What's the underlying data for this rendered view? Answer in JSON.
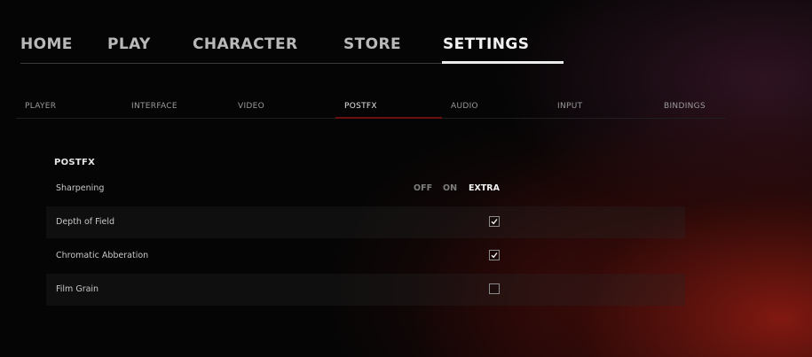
{
  "top_nav": {
    "tabs": [
      {
        "label": "HOME"
      },
      {
        "label": "PLAY"
      },
      {
        "label": "CHARACTER"
      },
      {
        "label": "STORE"
      },
      {
        "label": "SETTINGS"
      }
    ],
    "active": "SETTINGS"
  },
  "sub_nav": {
    "tabs": [
      {
        "label": "PLAYER"
      },
      {
        "label": "INTERFACE"
      },
      {
        "label": "VIDEO"
      },
      {
        "label": "POSTFX"
      },
      {
        "label": "AUDIO"
      },
      {
        "label": "INPUT"
      },
      {
        "label": "BINDINGS"
      }
    ],
    "active": "POSTFX"
  },
  "postfx": {
    "section_title": "POSTFX",
    "sharpening": {
      "label": "Sharpening",
      "options": [
        "OFF",
        "ON",
        "EXTRA"
      ],
      "selected": "EXTRA"
    },
    "depth_of_field": {
      "label": "Depth of Field",
      "checked": true
    },
    "chromatic_abberation": {
      "label": "Chromatic Abberation",
      "checked": true
    },
    "film_grain": {
      "label": "Film Grain",
      "checked": false
    }
  }
}
